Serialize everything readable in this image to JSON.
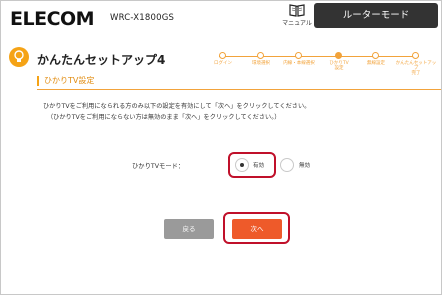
{
  "header": {
    "logo": "ELECOM",
    "model": "WRC-X1800GS",
    "manual_label": "マニュアル",
    "mode_button": "ルーターモード"
  },
  "page": {
    "title": "かんたんセットアップ4"
  },
  "steps": [
    {
      "label": "ログイン",
      "active": false
    },
    {
      "label": "環境選択",
      "active": false
    },
    {
      "label": "内線・本線選択",
      "active": false
    },
    {
      "label": "ひかりTV\n設定",
      "active": true
    },
    {
      "label": "無線設定",
      "active": false
    },
    {
      "label": "かんたんセットアップ\n完了",
      "active": false
    }
  ],
  "section": {
    "title": "ひかりTV設定",
    "description_line1": "ひかりTVをご利用になられる方のみ以下の設定を有効にして「次へ」をクリックしてください。",
    "description_line2": "（ひかりTVをご利用にならない方は無効のまま「次へ」をクリックしてください。）"
  },
  "form": {
    "field_label": "ひかりTVモード：",
    "options": [
      {
        "label": "有効",
        "selected": true
      },
      {
        "label": "無効",
        "selected": false
      }
    ]
  },
  "buttons": {
    "back": "戻る",
    "next": "次へ"
  },
  "colors": {
    "accent_orange": "#f5a316",
    "next_button": "#ee5a2a",
    "back_button": "#9a9a9a",
    "highlight_red": "#c0102a",
    "mode_button_bg": "#333333"
  }
}
